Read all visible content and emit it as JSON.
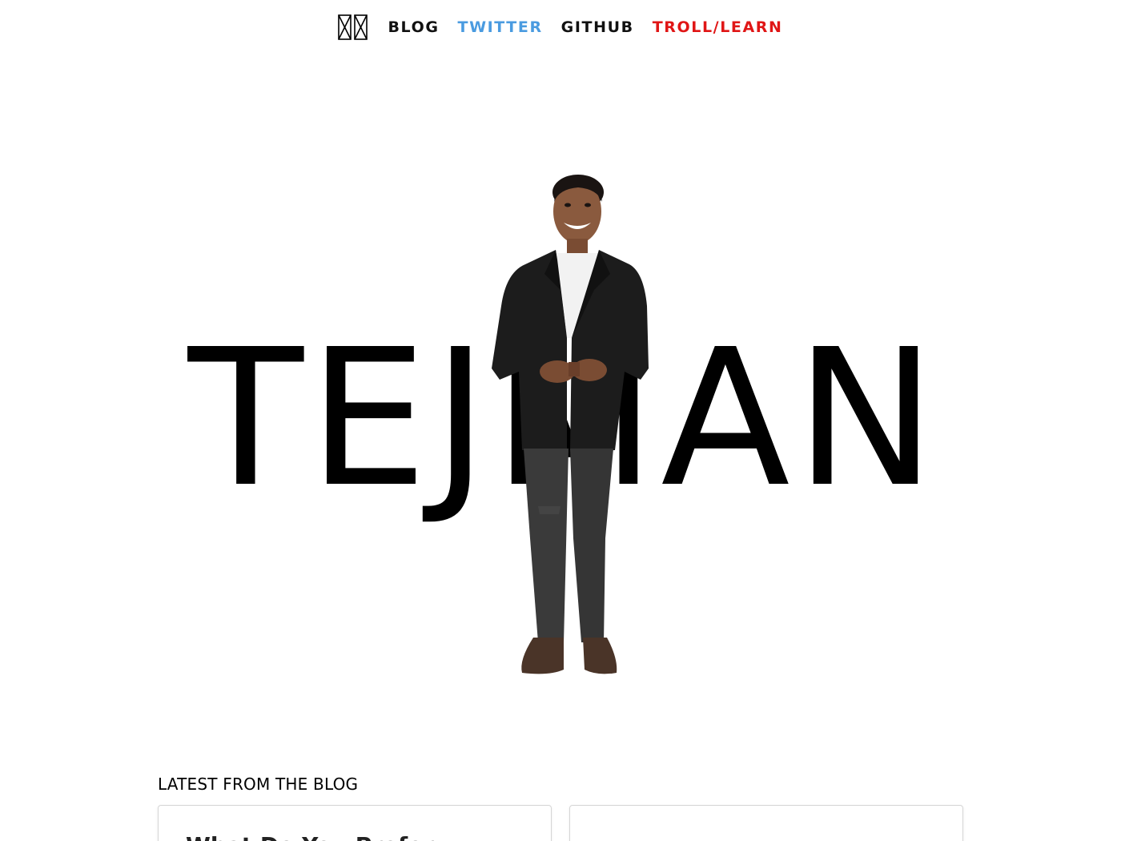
{
  "nav": {
    "logo_icon": "tofu-glyph-logo-icon",
    "links": [
      {
        "label": "BLOG",
        "color": "#111111"
      },
      {
        "label": "TWITTER",
        "color": "#4a9be0"
      },
      {
        "label": "GITHUB",
        "color": "#111111"
      },
      {
        "label": "TROLL/LEARN",
        "color": "#e01616"
      }
    ]
  },
  "hero": {
    "name": "TEJMAN",
    "photo_icon": "person-standing-photo"
  },
  "blog": {
    "heading": "LATEST FROM THE BLOG",
    "cards": [
      {
        "title": "What Do You Prefer"
      },
      {
        "title": ""
      }
    ]
  }
}
